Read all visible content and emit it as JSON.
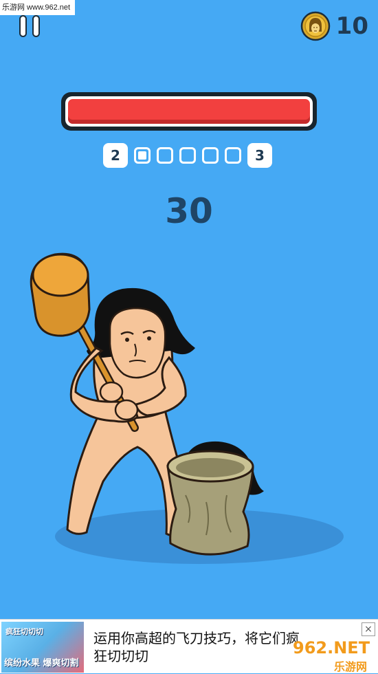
{
  "watermark": {
    "top_text": "乐游网 www.962.net",
    "bottom_text": "962.NET",
    "bottom_sub": "乐游网"
  },
  "hud": {
    "coins": "10",
    "coin_icon": "coin-face-icon",
    "pause_icon": "pause-icon"
  },
  "health_bar": {
    "fill_fraction": 1.0,
    "color": "#f2403f"
  },
  "stage_progress": {
    "current_stage": "2",
    "next_stage": "3",
    "total_steps": 5,
    "completed_steps": 1
  },
  "counter": {
    "value": "30"
  },
  "ad": {
    "thumb_label": "缤纷水果 爆爽切割",
    "thumb_title": "疯狂切切切",
    "text": "运用你高超的飞刀技巧，将它们疯狂切切切",
    "close_icon": "close-icon"
  },
  "colors": {
    "background": "#45a9f4",
    "accent_red": "#f2403f",
    "text_dark": "#1f3a52"
  }
}
